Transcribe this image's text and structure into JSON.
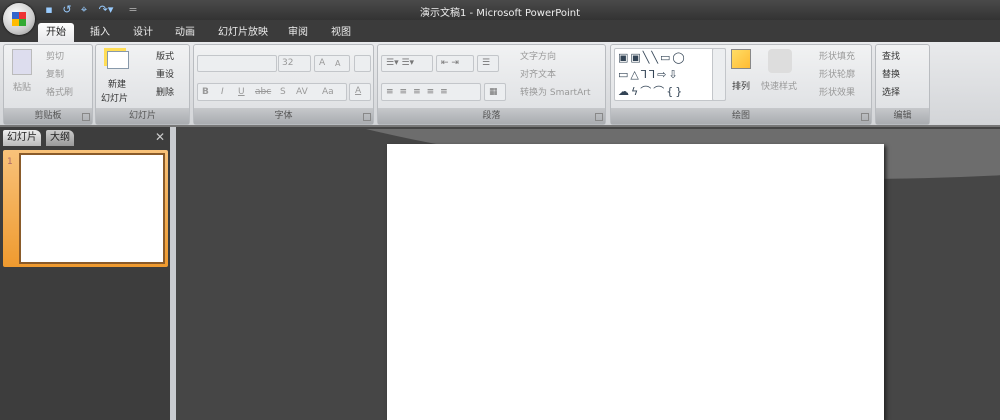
{
  "window": {
    "title": "演示文稿1 - Microsoft PowerPoint"
  },
  "quick_access": {
    "customize": "="
  },
  "tabs": [
    "开始",
    "插入",
    "设计",
    "动画",
    "幻灯片放映",
    "审阅",
    "视图"
  ],
  "ribbon": {
    "clipboard": {
      "label": "剪贴板",
      "paste": "粘贴",
      "cut": "剪切",
      "copy": "复制",
      "format_painter": "格式刷"
    },
    "slides": {
      "label": "幻灯片",
      "new_slide_1": "新建",
      "new_slide_2": "幻灯片",
      "layout": "版式",
      "reset": "重设",
      "delete": "删除"
    },
    "font": {
      "label": "字体",
      "font_name": "",
      "font_size": "32",
      "bold": "B",
      "italic": "I",
      "underline": "U",
      "strike": "abc",
      "shadow": "S",
      "spacing": "AV",
      "case": "Aa",
      "grow": "A",
      "shrink": "A",
      "color": "A"
    },
    "paragraph": {
      "label": "段落",
      "text_direction": "文字方向",
      "align_text": "对齐文本",
      "smartart": "转换为 SmartArt"
    },
    "drawing": {
      "label": "绘图",
      "arrange": "排列",
      "quick_styles": "快速样式",
      "shape_fill": "形状填充",
      "shape_outline": "形状轮廓",
      "shape_effects": "形状效果"
    },
    "editing": {
      "label": "编辑",
      "find": "查找",
      "replace": "替换",
      "select": "选择"
    }
  },
  "pane": {
    "tabs": [
      "幻灯片",
      "大纲"
    ],
    "close": "✕",
    "slide_number": "1"
  }
}
